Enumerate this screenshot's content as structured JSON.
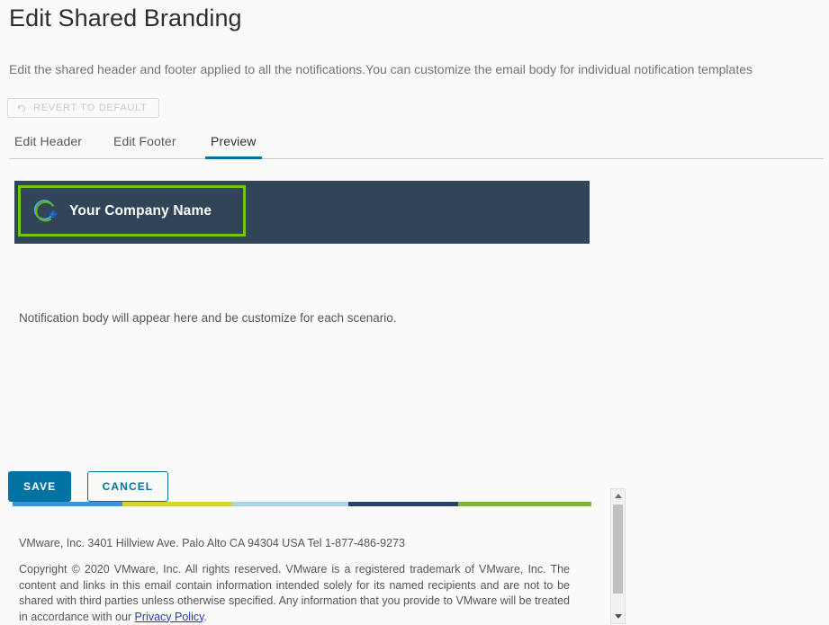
{
  "page": {
    "title": "Edit Shared Branding",
    "description": "Edit the shared header and footer applied to all the notifications.You can customize the email body for individual notification templates"
  },
  "revert_button": {
    "label": "REVERT TO DEFAULT",
    "icon": "undo-arrow-icon",
    "disabled": true
  },
  "tabs": [
    {
      "label": "Edit Header",
      "active": false
    },
    {
      "label": "Edit Footer",
      "active": false
    },
    {
      "label": "Preview",
      "active": true
    }
  ],
  "preview": {
    "banner": {
      "background_color": "#324558",
      "selection_border_color": "#6ec80a",
      "logo_icon": "company-logo-icon",
      "company_name": "Your Company Name"
    },
    "body_text": "Notification body will appear here and be customize for each scenario.",
    "color_strip": [
      {
        "color": "#3a94d9",
        "width_pct": 19
      },
      {
        "color": "#d4d13e",
        "width_pct": 19
      },
      {
        "color": "#a8d3e8",
        "width_pct": 20
      },
      {
        "color": "#2b3f6b",
        "width_pct": 19
      },
      {
        "color": "#7cb342",
        "width_pct": 23
      }
    ],
    "footer_address": "VMware, Inc. 3401 Hillview Ave. Palo Alto CA 94304 USA Tel 1-877-486-9273",
    "copyright": {
      "text_before_link": "Copyright © 2020 VMware, Inc. All rights reserved. VMware is a registered trademark of VMware, Inc. The content and links in this email contain information intended solely for its named recipients and are not to be shared with third parties unless otherwise specified. Any information that you provide to VMware will be treated in accordance with our ",
      "link_text": "Privacy Policy",
      "text_after_link": "."
    },
    "scrollbar": {
      "up_icon": "caret-up-icon",
      "down_icon": "caret-down-icon"
    }
  },
  "actions": {
    "save_label": "SAVE",
    "cancel_label": "CANCEL"
  },
  "colors": {
    "accent": "#0072a3",
    "brand_green": "#6ec80a",
    "banner_dark": "#324558",
    "link_blue": "#2638c4"
  }
}
